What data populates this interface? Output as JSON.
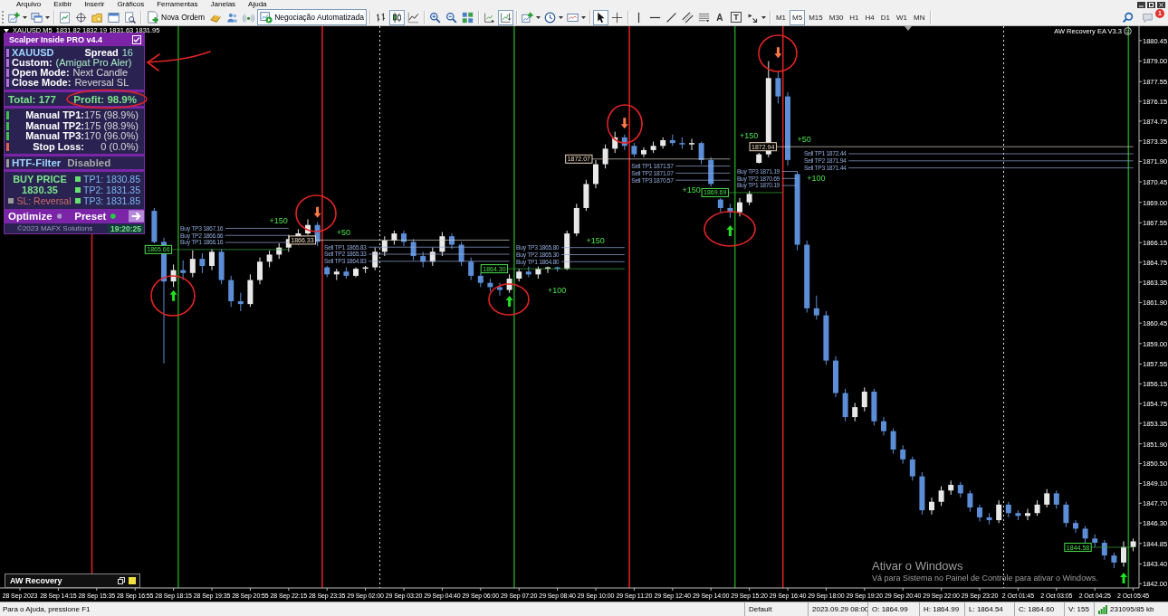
{
  "menu": [
    "Arquivo",
    "Exibir",
    "Inserir",
    "Gráficos",
    "Ferramentas",
    "Janelas",
    "Ajuda"
  ],
  "toolbar": {
    "new_order": "Nova Ordem",
    "autotrading": {
      "label": "Negociação Automatizada",
      "on": true
    },
    "chart_types": [
      {
        "kind": "bars",
        "selected": false
      },
      {
        "kind": "candles",
        "selected": true
      },
      {
        "kind": "line",
        "selected": false
      }
    ],
    "view_toggles": [
      {
        "kind": "chart_shift",
        "selected": false
      },
      {
        "kind": "autoscroll",
        "selected": true
      }
    ],
    "cursor_tools": [
      {
        "kind": "cursor",
        "selected": true
      },
      {
        "kind": "crosshair",
        "selected": false
      }
    ],
    "text_tool": "A",
    "label_tool": "T",
    "timeframes": [
      {
        "label": "M1",
        "selected": false
      },
      {
        "label": "M5",
        "selected": true
      },
      {
        "label": "M15",
        "selected": false
      },
      {
        "label": "M30",
        "selected": false
      },
      {
        "label": "H1",
        "selected": false
      },
      {
        "label": "H4",
        "selected": false
      },
      {
        "label": "D1",
        "selected": false
      },
      {
        "label": "W1",
        "selected": false
      },
      {
        "label": "MN",
        "selected": false
      }
    ],
    "notification_count": "1"
  },
  "chart": {
    "symbol": "XAUUSD,M5",
    "quote": "1831.82 1832.19 1831.63 1831.95",
    "expert": "AW Recovery EA V3.3",
    "chart_data": [
      {
        "type": "candlestick",
        "grid": false,
        "ylim": [
          1841.7,
          1881.47
        ],
        "yticks": [
          1880.45,
          {
            "value": 1879,
            "label": "1879.00"
          },
          1877.55,
          1876.15,
          1874.75,
          1873.35,
          {
            "value": 1871.9,
            "label": "1871.90"
          },
          1870.45,
          {
            "value": 1869,
            "label": "1869.00"
          },
          1867.55,
          1866.15,
          1864.75,
          1863.35,
          {
            "value": 1861.9,
            "label": "1861.90"
          },
          1860.45,
          {
            "value": 1859,
            "label": "1859.00"
          },
          1857.55,
          1856.15,
          1854.75,
          1853.35,
          {
            "value": 1851.9,
            "label": "1851.90"
          },
          {
            "value": 1850.5,
            "label": "1850.50"
          },
          {
            "value": 1849.1,
            "label": "1849.10"
          },
          {
            "value": 1847.7,
            "label": "1847.70"
          },
          {
            "value": 1846.3,
            "label": "1846.30"
          },
          1844.85,
          {
            "value": 1843.4,
            "label": "1843.40"
          },
          {
            "value": 1842,
            "label": "1842.00"
          }
        ],
        "categories": [
          "28 Sep 2023",
          null,
          null,
          null,
          "28 Sep 14:15",
          null,
          null,
          null,
          "28 Sep 15:35",
          null,
          null,
          null,
          "28 Sep 16:55",
          null,
          null,
          null,
          "28 Sep 18:15",
          null,
          null,
          null,
          "28 Sep 19:35",
          null,
          null,
          null,
          "28 Sep 20:55",
          null,
          null,
          null,
          "28 Sep 22:15",
          null,
          null,
          null,
          "28 Sep 23:35",
          null,
          null,
          null,
          "29 Sep 02:00",
          null,
          null,
          null,
          "29 Sep 03:20",
          null,
          null,
          null,
          "29 Sep 04:40",
          null,
          null,
          null,
          "29 Sep 06:00",
          null,
          null,
          null,
          "29 Sep 07:20",
          null,
          null,
          null,
          "29 Sep 08:40",
          null,
          null,
          null,
          "29 Sep 10:00",
          null,
          null,
          null,
          "29 Sep 11:20",
          null,
          null,
          null,
          "29 Sep 12:40",
          null,
          null,
          null,
          "29 Sep 14:00",
          null,
          null,
          null,
          "29 Sep 15:20",
          null,
          null,
          null,
          "29 Sep 16:40",
          null,
          null,
          null,
          "29 Sep 18:00",
          null,
          null,
          null,
          "29 Sep 19:20",
          null,
          null,
          null,
          "29 Sep 20:40",
          null,
          null,
          null,
          "29 Sep 22:00",
          null,
          null,
          null,
          "29 Sep 23:20",
          null,
          null,
          null,
          "2 Oct 01:45",
          null,
          null,
          null,
          "2 Oct 03:05",
          null,
          null,
          null,
          "2 Oct 04:25",
          null,
          null,
          null,
          "2 Oct 05:45"
        ],
        "ohlc": [
          null,
          null,
          null,
          null,
          null,
          null,
          null,
          null,
          null,
          null,
          null,
          null,
          null,
          null,
          [
            1868.4,
            1868.6,
            1866.1,
            1866.2
          ],
          [
            1866.2,
            1866.5,
            1857.6,
            1863.4
          ],
          [
            1863.4,
            1864.6,
            1863.0,
            1864.2
          ],
          [
            1864.2,
            1864.9,
            1863.5,
            1864.0
          ],
          [
            1864.0,
            1865.6,
            1863.7,
            1865.0
          ],
          [
            1865.0,
            1865.4,
            1864.0,
            1864.5
          ],
          [
            1864.5,
            1865.7,
            1864.2,
            1865.5
          ],
          [
            1865.5,
            1865.7,
            1863.2,
            1863.5
          ],
          [
            1863.5,
            1863.8,
            1861.6,
            1862.0
          ],
          [
            1862.0,
            1862.6,
            1861.3,
            1861.8
          ],
          [
            1861.8,
            1863.9,
            1861.6,
            1863.5
          ],
          [
            1863.5,
            1865.1,
            1863.2,
            1864.8
          ],
          [
            1864.8,
            1865.6,
            1864.4,
            1865.3
          ],
          [
            1865.3,
            1866.1,
            1865.0,
            1865.8
          ],
          [
            1865.8,
            1866.7,
            1865.5,
            1866.4
          ],
          [
            1866.4,
            1867.1,
            1866.0,
            1866.8
          ],
          [
            1866.8,
            1867.8,
            1866.7,
            1867.4
          ],
          [
            1867.4,
            1867.6,
            1865.9,
            1866.2
          ],
          [
            1864.4,
            1864.5,
            1863.7,
            1863.9
          ],
          [
            1863.9,
            1864.3,
            1863.5,
            1864.1
          ],
          [
            1864.1,
            1864.4,
            1863.6,
            1863.8
          ],
          [
            1863.8,
            1864.4,
            1863.7,
            1864.3
          ],
          [
            1864.3,
            1864.5,
            1864.0,
            1864.4
          ],
          [
            1864.4,
            1865.8,
            1864.2,
            1865.5
          ],
          [
            1865.5,
            1866.6,
            1865.2,
            1866.3
          ],
          [
            1866.3,
            1867.0,
            1866.0,
            1866.8
          ],
          [
            1866.8,
            1867.0,
            1865.9,
            1866.2
          ],
          [
            1866.2,
            1866.4,
            1864.9,
            1865.2
          ],
          [
            1865.2,
            1865.5,
            1864.4,
            1864.8
          ],
          [
            1864.8,
            1865.8,
            1864.5,
            1865.5
          ],
          [
            1865.5,
            1866.9,
            1865.2,
            1866.6
          ],
          [
            1866.6,
            1866.8,
            1865.7,
            1866.0
          ],
          [
            1866.0,
            1866.2,
            1864.5,
            1864.8
          ],
          [
            1864.8,
            1865.1,
            1863.5,
            1863.8
          ],
          [
            1863.8,
            1864.0,
            1863.0,
            1863.3
          ],
          [
            1863.3,
            1863.6,
            1862.7,
            1863.0
          ],
          [
            1863.0,
            1863.3,
            1862.4,
            1862.8
          ],
          [
            1862.8,
            1863.9,
            1862.6,
            1863.6
          ],
          [
            1863.6,
            1864.3,
            1863.4,
            1864.1
          ],
          [
            1864.1,
            1864.45,
            1863.7,
            1863.9
          ],
          [
            1863.9,
            1864.45,
            1863.6,
            1864.3
          ],
          [
            1864.3,
            1864.45,
            1864.0,
            1864.4
          ],
          [
            1864.4,
            1864.45,
            1864.1,
            1864.3
          ],
          [
            1864.3,
            1867.0,
            1864.2,
            1866.8
          ],
          [
            1866.8,
            1868.9,
            1866.6,
            1868.6
          ],
          [
            1868.6,
            1870.6,
            1868.4,
            1870.3
          ],
          [
            1870.3,
            1872.0,
            1870.0,
            1871.7
          ],
          [
            1871.7,
            1873.1,
            1871.4,
            1872.8
          ],
          [
            1872.8,
            1874.0,
            1872.5,
            1873.6
          ],
          [
            1873.6,
            1873.8,
            1872.7,
            1873.0
          ],
          [
            1873.0,
            1873.2,
            1872.2,
            1872.4
          ],
          [
            1872.4,
            1872.9,
            1872.2,
            1872.7
          ],
          [
            1872.7,
            1873.3,
            1872.5,
            1873.0
          ],
          [
            1873.0,
            1873.6,
            1872.8,
            1873.4
          ],
          [
            1873.4,
            1873.8,
            1873.0,
            1873.2
          ],
          [
            1873.2,
            1873.6,
            1872.8,
            1873.1
          ],
          [
            1873.1,
            1873.5,
            1872.7,
            1873.2
          ],
          [
            1873.2,
            1873.3,
            1871.7,
            1872.0
          ],
          [
            1872.0,
            1872.2,
            1870.1,
            1870.3
          ],
          [
            1869.2,
            1869.3,
            1868.3,
            1868.6
          ],
          [
            1868.6,
            1868.9,
            1867.9,
            1868.3
          ],
          [
            1868.3,
            1869.3,
            1868.0,
            1869.0
          ],
          [
            1869.0,
            1869.8,
            1868.8,
            1869.6
          ],
          [
            1871.8,
            1872.5,
            1871.75,
            1872.4
          ],
          [
            1872.4,
            1879.0,
            1872.2,
            1877.8
          ],
          [
            1877.8,
            1878.3,
            1876.0,
            1876.5
          ],
          [
            1876.5,
            1876.8,
            1871.6,
            1872.0
          ],
          [
            1871.0,
            1871.2,
            1865.6,
            1866.0
          ],
          [
            1866.0,
            1866.3,
            1861.2,
            1861.5
          ],
          [
            1861.5,
            1862.4,
            1860.7,
            1861.0
          ],
          [
            1861.0,
            1861.3,
            1857.5,
            1857.8
          ],
          [
            1857.8,
            1858.1,
            1855.2,
            1855.5
          ],
          [
            1855.5,
            1855.8,
            1853.5,
            1853.8
          ],
          [
            1853.8,
            1854.8,
            1853.5,
            1854.5
          ],
          [
            1854.5,
            1855.9,
            1854.2,
            1855.6
          ],
          [
            1855.6,
            1855.8,
            1853.2,
            1853.5
          ],
          [
            1853.5,
            1853.8,
            1852.5,
            1852.8
          ],
          [
            1852.8,
            1853.0,
            1851.2,
            1851.5
          ],
          [
            1851.5,
            1851.8,
            1850.5,
            1850.8
          ],
          [
            1850.8,
            1851.0,
            1849.3,
            1849.6
          ],
          [
            1849.6,
            1849.9,
            1846.9,
            1847.2
          ],
          [
            1847.2,
            1848.1,
            1846.9,
            1847.8
          ],
          [
            1847.8,
            1848.9,
            1847.5,
            1848.6
          ],
          [
            1848.6,
            1849.3,
            1848.3,
            1849.0
          ],
          [
            1849.0,
            1849.2,
            1848.1,
            1848.4
          ],
          [
            1848.4,
            1848.6,
            1847.1,
            1847.4
          ],
          [
            1847.4,
            1847.6,
            1846.4,
            1846.7
          ],
          [
            1846.7,
            1847.0,
            1846.2,
            1846.5
          ],
          [
            1846.5,
            1847.9,
            1846.3,
            1847.6
          ],
          [
            1847.6,
            1847.8,
            1846.7,
            1847.0
          ],
          [
            1847.0,
            1847.2,
            1846.5,
            1846.8
          ],
          [
            1846.8,
            1847.3,
            1846.5,
            1847.0
          ],
          [
            1847.0,
            1847.9,
            1846.8,
            1847.6
          ],
          [
            1847.6,
            1848.7,
            1847.4,
            1848.4
          ],
          [
            1848.4,
            1848.6,
            1847.3,
            1847.6
          ],
          [
            1847.6,
            1847.8,
            1846.0,
            1846.3
          ],
          [
            1846.3,
            1846.5,
            1845.6,
            1845.9
          ],
          [
            1845.9,
            1846.1,
            1844.9,
            1845.2
          ],
          [
            1845.2,
            1845.5,
            1844.6,
            1844.9
          ],
          [
            1844.9,
            1845.1,
            1843.7,
            1844.0
          ],
          [
            1844.0,
            1844.2,
            1843.1,
            1843.5
          ],
          [
            1843.5,
            1845.0,
            1843.2,
            1844.6
          ],
          [
            1844.6,
            1845.2,
            1844.3,
            1845.0
          ]
        ],
        "annotations": [
          "Buy TP3 1867.16",
          "Buy TP2 1866.66",
          "Buy TP1 1866.16",
          "1865.66",
          "+150",
          "Sell TP1 1865.83",
          "Sell TP2 1865.33",
          "Sell TP3 1864.83",
          "1866.33",
          "+50",
          "Buy TP3 1865.80",
          "Buy TP2 1865.30",
          "Buy TP1 1864.80",
          "1864.30",
          "+150",
          "+100",
          "Sell TP1 1871.57",
          "Sell TP2 1871.07",
          "Sell TP3 1870.57",
          "1872.07",
          "+150",
          "Buy TP3 1871.19",
          "Buy TP2 1870.69",
          "Buy TP1 1870.19",
          "1869.69",
          "+150",
          "Sell TP1 1872.44",
          "Sell TP2 1871.94",
          "Sell TP3 1871.44",
          "1872.94",
          "+50",
          "+100",
          "1844.58"
        ]
      }
    ]
  },
  "scalper_panel": {
    "title": "Scalper Inside PRO v4.4",
    "checked": true,
    "symbol": "XAUUSD",
    "spread_label": "Spread",
    "spread": "16",
    "settings": [
      {
        "label": "Custom:",
        "value": "(Amigat Pro Aler)",
        "color": "#a8ecc0"
      },
      {
        "label": "Open Mode:",
        "value": "Next Candle",
        "color": "#d8d8d8"
      },
      {
        "label": "Close Mode:",
        "value": "Reversal SL",
        "color": "#d8d8d8"
      }
    ],
    "total": "Total: 177",
    "profit": "Profit: 98.9%",
    "stats": [
      {
        "label": "Manual TP1:",
        "value": "175 (98.9%)",
        "color": "#3cc04a"
      },
      {
        "label": "Manual TP2:",
        "value": "175 (98.9%)",
        "color": "#3cc04a"
      },
      {
        "label": "Manual TP3:",
        "value": "170 (96.0%)",
        "color": "#3cc04a"
      },
      {
        "label": "Stop Loss:",
        "value": "0 (0.0%)",
        "color": "#e0604a"
      }
    ],
    "filter": {
      "label": "HTF-Filter",
      "value": "Disabled"
    },
    "signal": {
      "title": "BUY PRICE",
      "price": "1830.35",
      "stop_loss": "SL: Reversal",
      "targets": [
        "TP1: 1830.85",
        "TP2: 1831.35",
        "TP3: 1831.85"
      ]
    },
    "actions": [
      {
        "label": "Optimize",
        "color": "#a898c8"
      },
      {
        "label": "Preset",
        "color": "#22d040"
      }
    ],
    "copyright": "©2023 MAFX Solutions",
    "clock": "19:20:25"
  },
  "recovery_panel": {
    "title": "AW Recovery"
  },
  "windows_notice": {
    "title": "Ativar o Windows",
    "message": "Vá para Sistema no Painel de Controle para ativar o Windows."
  },
  "status_bar": {
    "help": "Para o Ajuda, pressione F1",
    "profile": "Default",
    "time": "2023.09.29 08:00",
    "open": "O: 1864.99",
    "high": "H: 1864.99",
    "low": "L: 1864.54",
    "close": "C: 1864.60",
    "volume": "V: 155",
    "traffic": "231095/85 kb"
  }
}
